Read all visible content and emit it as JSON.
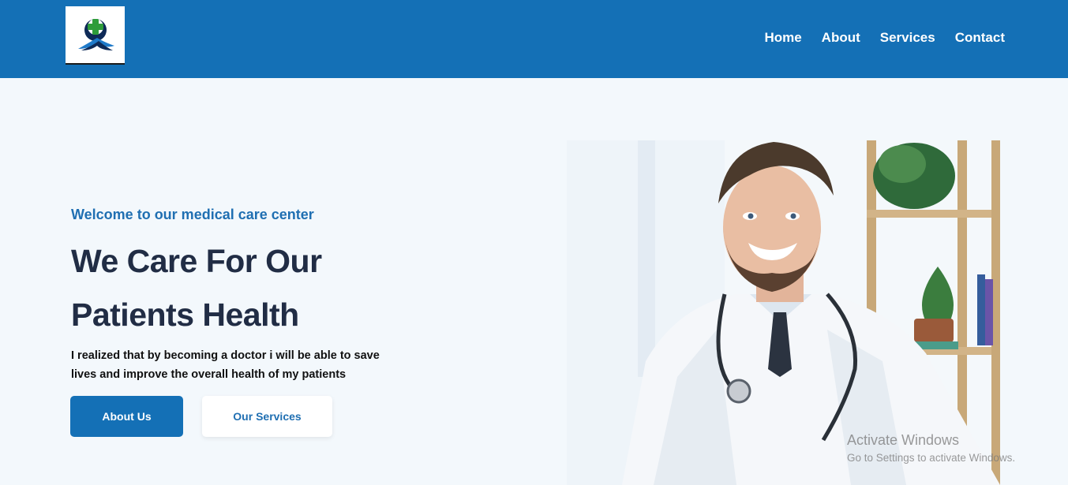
{
  "nav": {
    "logo_icon": "medical-cross-ribbon-logo",
    "links": [
      "Home",
      "About",
      "Services",
      "Contact"
    ]
  },
  "hero": {
    "welcome": "Welcome to our medical care center",
    "headline_line1": "We Care For Our",
    "headline_line2": "Patients Health",
    "description": "I realized that by becoming a doctor i will be able to save lives and improve the overall health of my patients",
    "buttons": {
      "primary": "About Us",
      "secondary": "Our Services"
    },
    "image_icon": "doctor-photo"
  },
  "watermark": {
    "title": "Activate Windows",
    "subtitle": "Go to Settings to activate Windows."
  },
  "colors": {
    "brand": "#1470b6",
    "heading": "#212d45",
    "background": "#f3f8fc"
  }
}
